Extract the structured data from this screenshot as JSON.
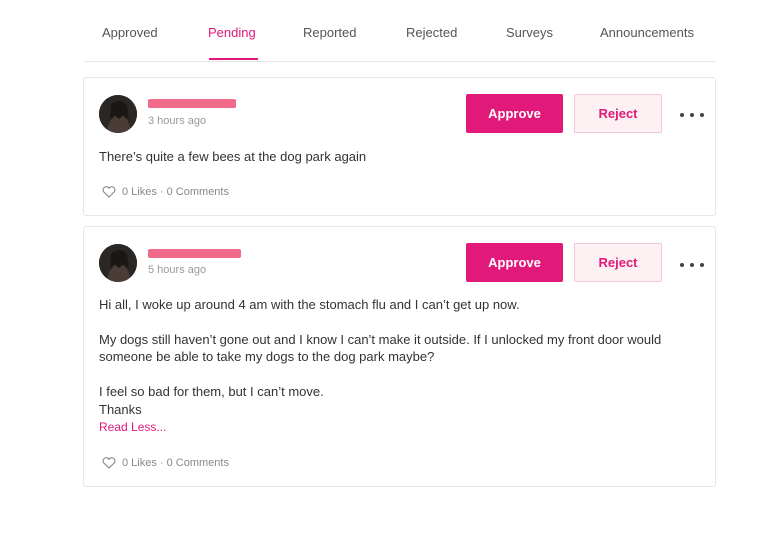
{
  "tabs": [
    {
      "label": "Approved"
    },
    {
      "label": "Pending"
    },
    {
      "label": "Reported"
    },
    {
      "label": "Rejected"
    },
    {
      "label": "Surveys"
    },
    {
      "label": "Announcements"
    }
  ],
  "active_tab": "Pending",
  "colors": {
    "accent": "#e0197a",
    "reject_bg": "#fdf1f4"
  },
  "posts": [
    {
      "time": "3 hours ago",
      "approve_label": "Approve",
      "reject_label": "Reject",
      "paragraphs": [
        "There’s quite a few bees at the dog park again"
      ],
      "stats": "0 Likes · 0 Comments"
    },
    {
      "time": "5 hours ago",
      "approve_label": "Approve",
      "reject_label": "Reject",
      "paragraphs": [
        "Hi all, I woke up around 4 am with the stomach flu and I can’t get up now.",
        "My dogs still haven’t gone out and I know I can’t make it outside. If I unlocked my front door would someone be able to take my dogs to the dog park maybe?",
        "I feel so bad for them, but I can’t move.",
        "Thanks"
      ],
      "read_less": "Read Less...",
      "stats": "0 Likes · 0 Comments"
    }
  ]
}
